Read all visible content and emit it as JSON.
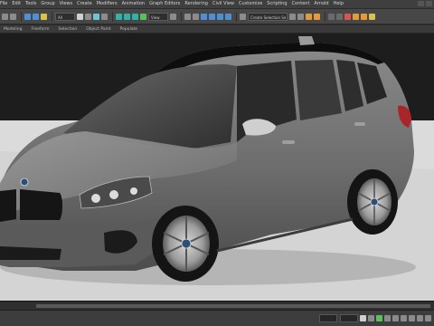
{
  "menu": {
    "items": [
      "File",
      "Edit",
      "Tools",
      "Group",
      "Views",
      "Create",
      "Modifiers",
      "Animation",
      "Graph Editors",
      "Rendering",
      "Civil View",
      "Customize",
      "Scripting",
      "Content",
      "Arnold",
      "Help"
    ]
  },
  "toolbar": {
    "selection_filter": "All",
    "view_dropdown": "View",
    "named_selection": "Create Selection Se"
  },
  "ribbon": {
    "tabs": [
      "Modeling",
      "Freeform",
      "Selection",
      "Object Paint",
      "Populate"
    ]
  },
  "viewport": {
    "label": "[+] [Perspective] [Standard] [Default Shading]",
    "subject": "car-model"
  },
  "colors": {
    "background": "#2a2a2a",
    "floor": "#d5d5d5",
    "car_body": "#6b6b6b",
    "accent_blue": "#4e8fd6"
  }
}
